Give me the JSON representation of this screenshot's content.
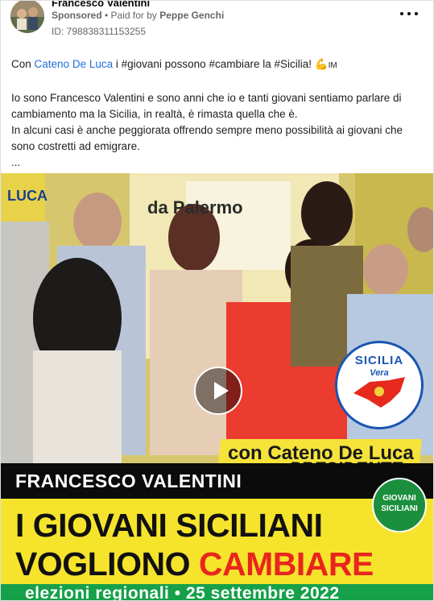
{
  "post": {
    "author": "Francesco Valentini",
    "sponsored_label": "Sponsored",
    "separator": " • ",
    "paid_for_prefix": "Paid for by ",
    "paid_for_name": "Peppe Genchi",
    "ad_id": "ID: 798838311153255"
  },
  "body": {
    "line1_prefix": "Con ",
    "line1_link": "Cateno De Luca",
    "line1_rest": " i #giovani possono #cambiare la #Sicilia! ",
    "line1_emoji": "💪",
    "line1_suffix": "IM",
    "para2": "Io sono Francesco Valentini e sono anni che io e tanti giovani sentiamo parlare di cambiamento ma la Sicilia, in realtà, è rimasta quella che è.",
    "para3": "In alcuni casi è anche peggiorata offrendo sempre meno possibilità ai giovani che sono costretti ad emigrare.",
    "ellipsis": "..."
  },
  "media": {
    "slogan_line1": "con Cateno De Luca",
    "slogan_line2": "PRESIDENTE",
    "candidate_name": "FRANCESCO VALENTINI",
    "headline_line1": "I GIOVANI SICILIANI",
    "headline_line2_start": "VOGLIONO ",
    "headline_line2_red": "CAMBIARE",
    "election_line": "elezioni regionali • 25 settembre 2022",
    "badge_line1": "GIOVANI",
    "badge_line2": "SICILIANI",
    "logo_title": "SICILIA",
    "logo_subtitle": "Vera",
    "backdrop_text_1": "da Palermo",
    "backdrop_text_2": "LUCA"
  },
  "colors": {
    "link": "#216fdb",
    "band_black": "#0b0b0b",
    "band_yellow": "#f6e42c",
    "band_green": "#16a04a",
    "headline_red": "#e8261d"
  }
}
